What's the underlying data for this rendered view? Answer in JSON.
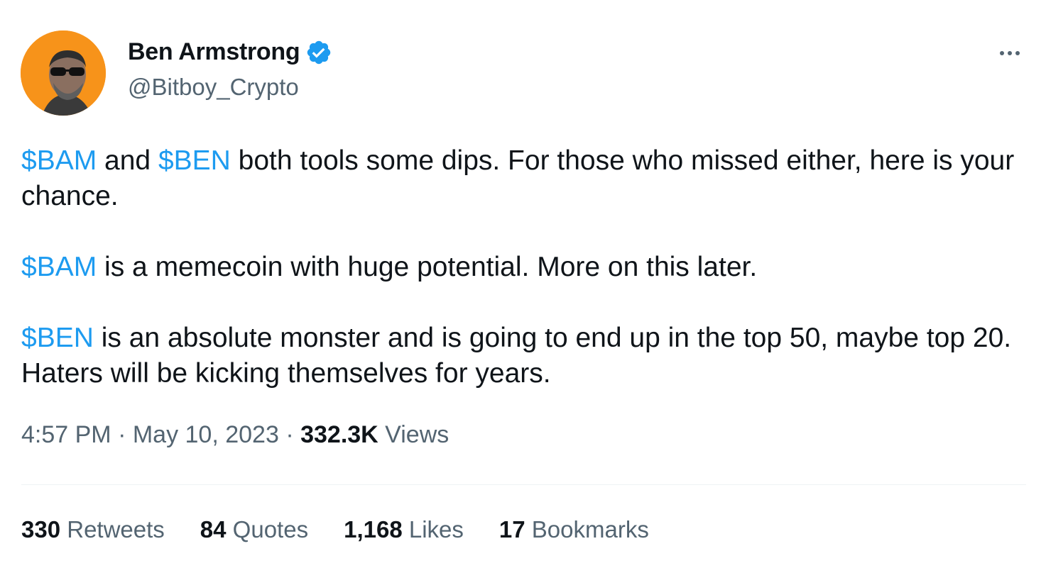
{
  "author": {
    "display_name": "Ben Armstrong",
    "handle": "@Bitboy_Crypto",
    "verified": true,
    "avatar_bg": "#f7931a"
  },
  "tweet": {
    "paragraphs": [
      [
        {
          "cashtag": "$BAM"
        },
        {
          "text": " and "
        },
        {
          "cashtag": "$BEN"
        },
        {
          "text": " both tools some dips. For those who missed either, here is your chance."
        }
      ],
      [
        {
          "cashtag": "$BAM"
        },
        {
          "text": " is a memecoin with huge potential. More on this later."
        }
      ],
      [
        {
          "cashtag": "$BEN"
        },
        {
          "text": " is an absolute monster and is going to end up in the top 50, maybe top 20. Haters will be kicking themselves for years."
        }
      ]
    ]
  },
  "meta": {
    "time": "4:57 PM",
    "separator": " · ",
    "date": "May 10, 2023",
    "views_count": "332.3K",
    "views_label": " Views"
  },
  "stats": [
    {
      "count": "330",
      "label": " Retweets"
    },
    {
      "count": "84",
      "label": " Quotes"
    },
    {
      "count": "1,168",
      "label": " Likes"
    },
    {
      "count": "17",
      "label": " Bookmarks"
    }
  ],
  "colors": {
    "link": "#1d9bf0",
    "secondary_text": "#536471",
    "primary_text": "#0f1419",
    "verified": "#1d9bf0"
  },
  "icons": {
    "verified": "verified-badge-icon",
    "more": "more-options-icon"
  }
}
